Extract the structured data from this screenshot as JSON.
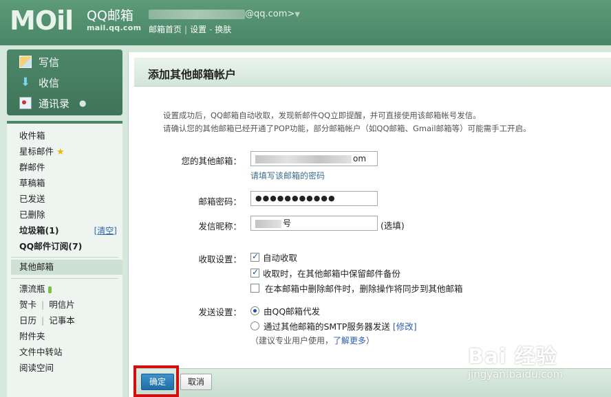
{
  "header": {
    "logo": "MOil",
    "brand_title": "QQ邮箱",
    "brand_sub": "mail.qq.com",
    "account_domain": "@qq.com>",
    "account_caret": "▼",
    "links": [
      "邮箱首页",
      "设置",
      "换肤"
    ]
  },
  "sidebar_top": {
    "compose": "写信",
    "inbox": "收信",
    "contacts": "通讯录"
  },
  "folders": {
    "inbox": "收件箱",
    "starred": "星标邮件",
    "group": "群邮件",
    "drafts": "草稿箱",
    "sent": "已发送",
    "deleted": "已删除",
    "spam": "垃圾箱(1)",
    "clear": "[清空]",
    "subscriptions": "QQ邮件订阅(7)",
    "other": "其他邮箱",
    "bottle": "漂流瓶",
    "card": "贺卡",
    "postcard": "明信片",
    "calendar": "日历",
    "notebook": "记事本",
    "attachments": "附件夹",
    "transfer": "文件中转站",
    "reading": "阅读空间"
  },
  "main": {
    "title": "添加其他邮箱帐户",
    "intro1": "设置成功后，QQ邮箱自动收取，发现新邮件QQ立即提醒，并可直接使用该邮箱帐号发信。",
    "intro2": "请确认您的其他邮箱已经开通了POP功能，部分邮箱帐户（如QQ邮箱、Gmail邮箱等）可能需手工开启。",
    "email_label": "您的其他邮箱：",
    "email_suffix": "om",
    "email_hint": "请填写该邮箱的密码",
    "password_label": "邮箱密码：",
    "password_value": "●●●●●●●●●●●",
    "nick_label": "发信昵称：",
    "nick_suffix": "号",
    "nick_aside": "(选填)",
    "receive_label": "收取设置：",
    "receive_opt1": "自动收取",
    "receive_opt2": "收取时，在其他邮箱中保留邮件备份",
    "receive_opt3": "在本邮箱中删除邮件时，删除操作将同步到其他邮箱",
    "send_label": "发送设置：",
    "send_opt1": "由QQ邮箱代发",
    "send_opt2": "通过其他邮箱的SMTP服务器发送",
    "send_modify": "[修改]",
    "send_note_prefix": "（建议专业用户使用，",
    "send_note_link": "了解更多",
    "send_note_suffix": "）"
  },
  "buttons": {
    "ok": "确定",
    "cancel": "取消"
  },
  "watermark": {
    "logo": "Bai 经验",
    "url": "jingyan.baidu.com"
  }
}
